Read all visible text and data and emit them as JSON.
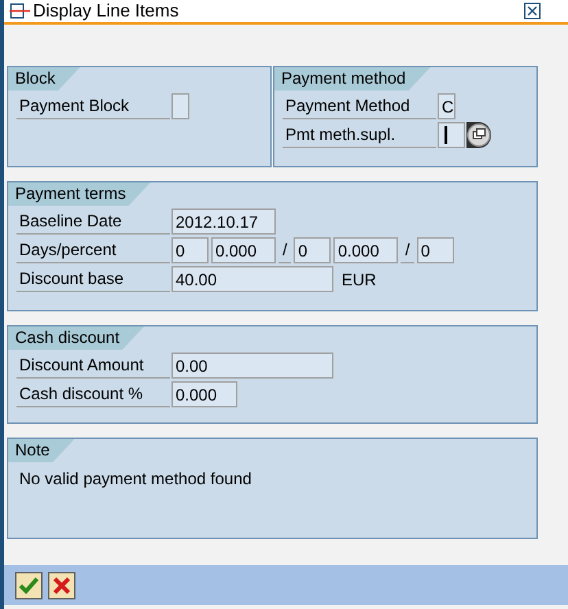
{
  "window": {
    "title": "Display Line Items"
  },
  "sections": [
    [
      {
        "title": "Block",
        "rows": [
          {
            "kind": "fields",
            "label": "Payment Block",
            "items": [
              {
                "kind": "field",
                "focused": false
              }
            ]
          }
        ]
      },
      {
        "title": "Payment method",
        "rows": [
          {
            "kind": "fields",
            "label": "Payment Method",
            "items": [
              {
                "kind": "field",
                "value": "C",
                "focused": false
              }
            ]
          },
          {
            "kind": "fields",
            "label": "Pmt meth.supl.",
            "items": [
              {
                "kind": "field",
                "focused": true
              },
              {
                "kind": "help_button"
              }
            ]
          }
        ]
      }
    ],
    [
      {
        "title": "Payment terms",
        "rows": [
          {
            "kind": "fields",
            "label": "Baseline Date",
            "items": [
              {
                "kind": "field",
                "value": "2012.10.17",
                "focused": false
              }
            ]
          },
          {
            "kind": "fields",
            "label": "Days/percent",
            "items": [
              {
                "kind": "field",
                "value": "0",
                "focused": false
              },
              {
                "kind": "field",
                "value": "0.000",
                "focused": false
              },
              {
                "kind": "separator",
                "text": "/"
              },
              {
                "kind": "field",
                "value": "0",
                "focused": false
              },
              {
                "kind": "field",
                "value": "0.000",
                "focused": false
              },
              {
                "kind": "separator",
                "text": "/"
              },
              {
                "kind": "field",
                "value": "0",
                "focused": false
              }
            ]
          },
          {
            "kind": "fields",
            "label": "Discount base",
            "items": [
              {
                "kind": "field",
                "value": "40.00",
                "focused": false
              },
              {
                "kind": "unit",
                "text": "EUR"
              }
            ]
          }
        ]
      }
    ],
    [
      {
        "title": "Cash discount",
        "rows": [
          {
            "kind": "fields",
            "label": "Discount Amount",
            "items": [
              {
                "kind": "field",
                "value": "0.00",
                "focused": false
              }
            ]
          },
          {
            "kind": "fields",
            "label": "Cash discount %",
            "items": [
              {
                "kind": "field",
                "value": "0.000",
                "focused": false
              }
            ]
          }
        ]
      }
    ],
    [
      {
        "title": "Note",
        "rows": [
          {
            "kind": "text",
            "text": "No valid payment method found"
          }
        ]
      }
    ]
  ],
  "footer": {
    "buttons": [
      {
        "kind": "confirm"
      },
      {
        "kind": "cancel"
      }
    ]
  }
}
